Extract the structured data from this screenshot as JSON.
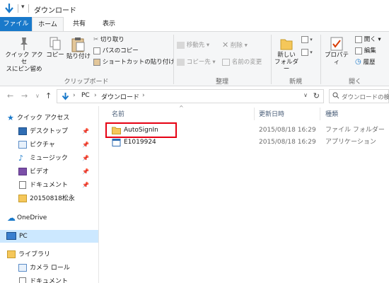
{
  "window": {
    "title": "ダウンロード",
    "qat_dropdown": "▾"
  },
  "ribbon_tabs": {
    "file": "ファイル",
    "home": "ホーム",
    "share": "共有",
    "view": "表示"
  },
  "ribbon": {
    "clipboard": {
      "pin_quick_access": [
        "クイック アクセ",
        "スにピン留め"
      ],
      "copy": "コピー",
      "paste": "貼り付け",
      "cut": "切り取り",
      "copy_path": "パスのコピー",
      "paste_shortcut": "ショートカットの貼り付け",
      "group_label": "クリップボード"
    },
    "organize": {
      "move_to": "移動先 ▾",
      "copy_to": "コピー先 ▾",
      "delete": "削除 ▾",
      "rename": "名前の変更",
      "group_label": "整理"
    },
    "new": {
      "new_folder": [
        "新しい",
        "フォルダー"
      ],
      "group_label": "新規"
    },
    "open": {
      "properties": "プロパティ",
      "open": "開く ▾",
      "edit": "編集",
      "history": "履歴",
      "group_label": "開く"
    }
  },
  "navigation": {
    "back": "←",
    "forward": "→",
    "recent": "∨",
    "up": "↑",
    "breadcrumb": [
      "PC",
      "ダウンロード"
    ],
    "separator": "›",
    "refresh": "↻",
    "search_placeholder": "ダウンロードの検索"
  },
  "sidebar": {
    "pin_glyph": "📌",
    "items": [
      {
        "label": "クイック アクセス",
        "icon": "star-icon"
      },
      {
        "label": "デスクトップ",
        "icon": "desktop-icon",
        "pinned": true
      },
      {
        "label": "ピクチャ",
        "icon": "pictures-icon",
        "pinned": true
      },
      {
        "label": "ミュージック",
        "icon": "music-icon",
        "pinned": true
      },
      {
        "label": "ビデオ",
        "icon": "video-icon",
        "pinned": true
      },
      {
        "label": "ドキュメント",
        "icon": "documents-icon",
        "pinned": true
      },
      {
        "label": "20150818松永",
        "icon": "folder-icon"
      },
      {
        "label": "OneDrive",
        "icon": "cloud-icon"
      },
      {
        "label": "PC",
        "icon": "pc-icon"
      },
      {
        "label": "ライブラリ",
        "icon": "library-icon"
      },
      {
        "label": "カメラ ロール",
        "icon": "camera-roll-icon"
      },
      {
        "label": "ドキュメント",
        "icon": "documents-icon"
      }
    ]
  },
  "file_list": {
    "columns": {
      "name": "名前",
      "modified": "更新日時",
      "type": "種類"
    },
    "sort_glyph": "^",
    "rows": [
      {
        "name": "AutoSignIn",
        "modified": "2015/08/18 16:29",
        "type": "ファイル フォルダー",
        "icon": "folder-icon"
      },
      {
        "name": "E1019924",
        "modified": "2015/08/18 16:29",
        "type": "アプリケーション",
        "icon": "application-icon"
      }
    ]
  },
  "colors": {
    "file_tab": "#1979ca",
    "selection": "#cce8ff",
    "highlight_box": "#e60012",
    "folder": "#f5c75a"
  }
}
